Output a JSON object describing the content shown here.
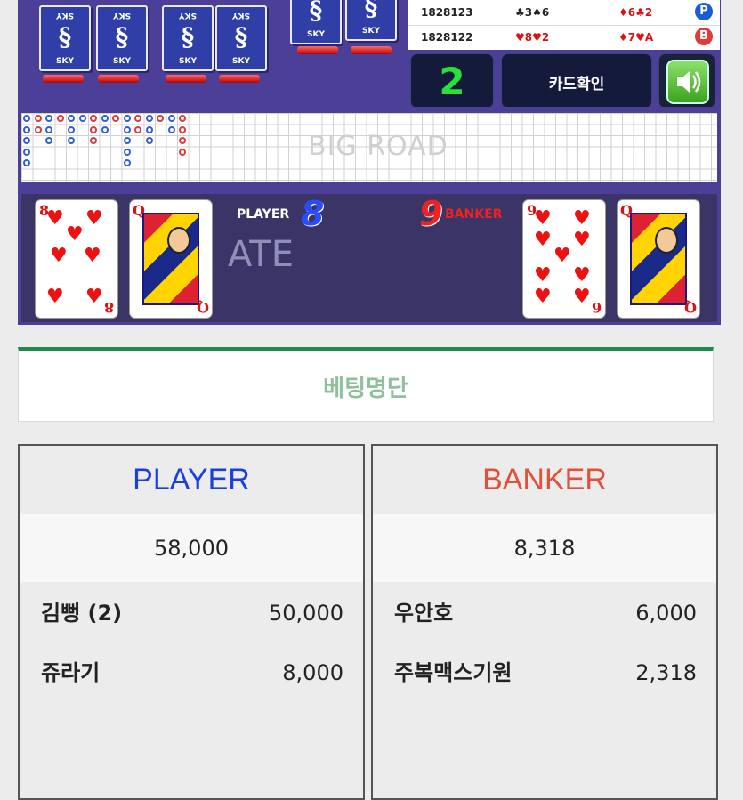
{
  "deck_label": "SKY",
  "history": [
    {
      "round": "1828123",
      "player_cards": "♣3♠6",
      "banker_cards": "♦6♣2",
      "winner": "P",
      "winner_color": "#1a5cd8"
    },
    {
      "round": "1828122",
      "player_cards": "♥8♥2",
      "banker_cards": "♦7♥A",
      "winner": "B",
      "winner_color": "#e03a3a"
    }
  ],
  "controls": {
    "count": "2",
    "check_button": "카드확인",
    "sound_icon": "speaker-icon"
  },
  "big_road_label": "BIG ROAD",
  "bead_overlay_label": "ATE",
  "result": {
    "player_label": "PLAYER",
    "player_score": "8",
    "banker_label": "BANKER",
    "banker_score": "9",
    "player_cards": [
      {
        "rank": "8",
        "suit": "♥"
      },
      {
        "rank": "Q",
        "suit": "♦"
      }
    ],
    "banker_cards": [
      {
        "rank": "9",
        "suit": "♥"
      },
      {
        "rank": "Q",
        "suit": "♦"
      }
    ],
    "banker_card_bottom_rank": "6"
  },
  "betting_title": "베팅명단",
  "player_panel": {
    "title": "PLAYER",
    "total": "58,000",
    "entries": [
      {
        "name": "김뻥 (2)",
        "amount": "50,000"
      },
      {
        "name": "쥬라기",
        "amount": "8,000"
      }
    ]
  },
  "banker_panel": {
    "title": "BANKER",
    "total": "8,318",
    "entries": [
      {
        "name": "우안호",
        "amount": "6,000"
      },
      {
        "name": "주복맥스기원",
        "amount": "2,318"
      }
    ]
  },
  "colors": {
    "player": "#1a3fe0",
    "banker": "#e0503a",
    "accent_green": "#1e8a4a",
    "board": "#4b3f98"
  }
}
